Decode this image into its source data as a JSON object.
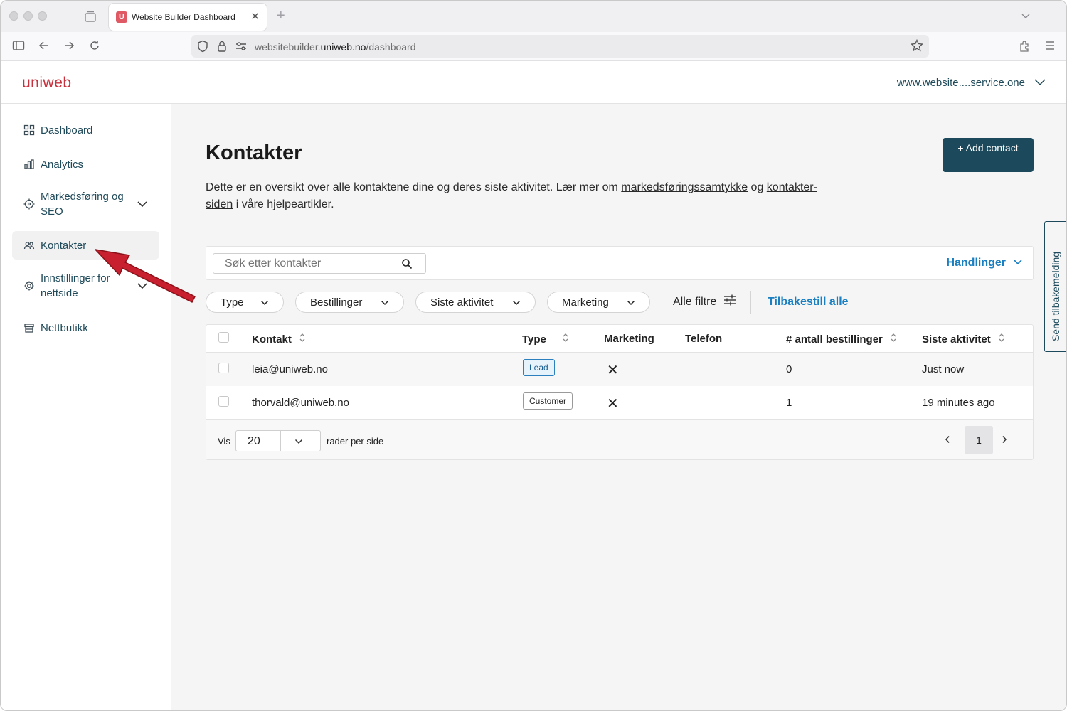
{
  "browser": {
    "tab_title": "Website Builder Dashboard",
    "tab_favicon": "U",
    "url_prefix": "websitebuilder.",
    "url_domain": "uniweb.no",
    "url_path": "/dashboard"
  },
  "header": {
    "logo": "uniweb",
    "site_name": "www.website....service.one"
  },
  "sidebar": {
    "items": [
      {
        "label": "Dashboard",
        "icon": "grid-icon"
      },
      {
        "label": "Analytics",
        "icon": "bar-chart-icon"
      },
      {
        "label": "Markedsføring og SEO",
        "icon": "target-icon"
      },
      {
        "label": "Kontakter",
        "icon": "users-icon"
      },
      {
        "label": "Innstillinger for nettside",
        "icon": "gear-icon"
      },
      {
        "label": "Nettbutikk",
        "icon": "store-icon"
      }
    ]
  },
  "main": {
    "title": "Kontakter",
    "desc_1": "Dette er en oversikt over alle kontaktene dine og deres siste aktivitet. Lær mer om ",
    "desc_link_1": "markedsføringssamtykke",
    "desc_2": " og ",
    "desc_link_2": "kontakter-siden",
    "desc_3": " i våre hjelpeartikler.",
    "add_button": "+ Add contact",
    "search_placeholder": "Søk etter kontakter",
    "actions": "Handlinger",
    "filters": [
      "Type",
      "Bestillinger",
      "Siste aktivitet",
      "Marketing"
    ],
    "all_filters": "Alle filtre",
    "reset_all": "Tilbakestill alle"
  },
  "table": {
    "columns": [
      "Kontakt",
      "Type",
      "Marketing",
      "Telefon",
      "# antall bestillinger",
      "Siste aktivitet"
    ],
    "rows": [
      {
        "contact": "leia@uniweb.no",
        "type": "Lead",
        "marketing": "✕",
        "phone": "",
        "orders": "0",
        "last_activity": "Just now"
      },
      {
        "contact": "thorvald@uniweb.no",
        "type": "Customer",
        "marketing": "✕",
        "phone": "",
        "orders": "1",
        "last_activity": "19 minutes ago"
      }
    ]
  },
  "pagination": {
    "show_label": "Vis",
    "rows_per_page": "20",
    "rows_per_page_label": "rader per side",
    "current_page": "1"
  },
  "feedback": "Send tilbakemelding",
  "colors": {
    "brand_red": "#c8313d",
    "primary_dark": "#1c4a5c",
    "link_blue": "#1a7fc1",
    "arrow_red": "#c8202e"
  }
}
